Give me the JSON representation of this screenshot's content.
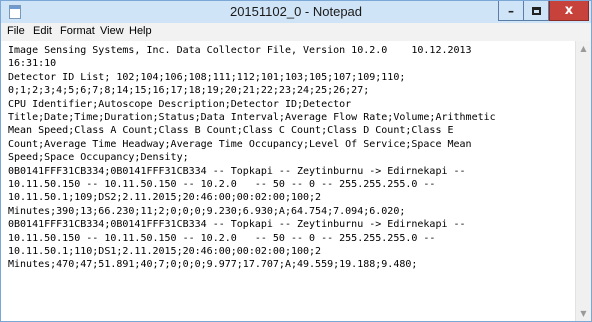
{
  "window": {
    "title": "20151102_0 - Notepad",
    "controls": {
      "minimize": "–",
      "close": "x"
    }
  },
  "menu": [
    "File",
    "Edit",
    "Format",
    "View",
    "Help"
  ],
  "editor": {
    "lines": [
      "Image Sensing Systems, Inc. Data Collector File, Version 10.2.0    10.12.2013",
      "16:31:10",
      "Detector ID List; 102;104;106;108;111;112;101;103;105;107;109;110;",
      "0;1;2;3;4;5;6;7;8;14;15;16;17;18;19;20;21;22;23;24;25;26;27;",
      "CPU Identifier;Autoscope Description;Detector ID;Detector",
      "Title;Date;Time;Duration;Status;Data Interval;Average Flow Rate;Volume;Arithmetic",
      "Mean Speed;Class A Count;Class B Count;Class C Count;Class D Count;Class E",
      "Count;Average Time Headway;Average Time Occupancy;Level Of Service;Space Mean",
      "Speed;Space Occupancy;Density;",
      "0B0141FFF31CB334;0B0141FFF31CB334 -- Topkapi -- Zeytinburnu -> Edirnekapi --",
      "10.11.50.150 -- 10.11.50.150 -- 10.2.0   -- 50 -- 0 -- 255.255.255.0 --",
      "10.11.50.1;109;DS2;2.11.2015;20:46:00;00:02:00;100;2",
      "Minutes;390;13;66.230;11;2;0;0;0;9.230;6.930;A;64.754;7.094;6.020;",
      "0B0141FFF31CB334;0B0141FFF31CB334 -- Topkapi -- Zeytinburnu -> Edirnekapi --",
      "10.11.50.150 -- 10.11.50.150 -- 10.2.0   -- 50 -- 0 -- 255.255.255.0 --",
      "10.11.50.1;110;DS1;2.11.2015;20:46:00;00:02:00;100;2",
      "Minutes;470;47;51.891;40;7;0;0;0;9.977;17.707;A;49.559;19.188;9.480;"
    ]
  },
  "scrollbar": {
    "up_arrow": "▲",
    "down_arrow": "▼"
  }
}
